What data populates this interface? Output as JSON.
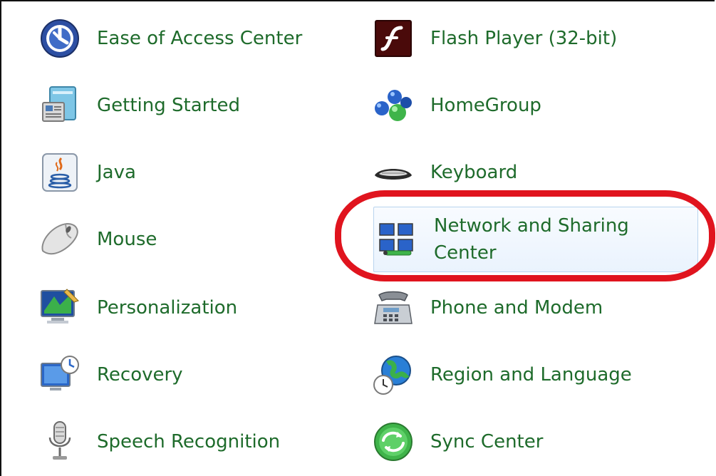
{
  "colors": {
    "link_text": "#1e6b2b",
    "highlight_border": "#b9d4ee",
    "annotation_red": "#e0141e"
  },
  "items_left": [
    {
      "label": "Ease of Access Center",
      "icon": "ease-of-access-icon"
    },
    {
      "label": "Getting Started",
      "icon": "getting-started-icon"
    },
    {
      "label": "Java",
      "icon": "java-icon"
    },
    {
      "label": "Mouse",
      "icon": "mouse-icon"
    },
    {
      "label": "Personalization",
      "icon": "personalization-icon"
    },
    {
      "label": "Recovery",
      "icon": "recovery-icon"
    },
    {
      "label": "Speech Recognition",
      "icon": "microphone-icon"
    }
  ],
  "items_right": [
    {
      "label": "Flash Player (32-bit)",
      "icon": "flash-player-icon"
    },
    {
      "label": "HomeGroup",
      "icon": "homegroup-icon"
    },
    {
      "label": "Keyboard",
      "icon": "keyboard-icon"
    },
    {
      "label": "Network and Sharing Center",
      "icon": "network-icon",
      "highlighted": true
    },
    {
      "label": "Phone and Modem",
      "icon": "phone-icon"
    },
    {
      "label": "Region and Language",
      "icon": "globe-clock-icon"
    },
    {
      "label": "Sync Center",
      "icon": "sync-icon"
    }
  ]
}
